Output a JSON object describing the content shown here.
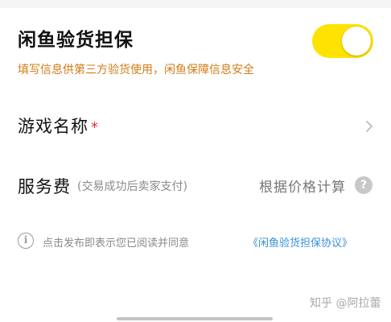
{
  "guarantee": {
    "title": "闲鱼验货担保",
    "description": "填写信息供第三方验货使用，闲鱼保障信息安全",
    "enabled": true,
    "toggle_color": "#ffe300"
  },
  "game_name": {
    "label": "游戏名称",
    "required_mark": "*",
    "icon": "chevron-right-icon"
  },
  "service_fee": {
    "label": "服务费",
    "note": "(交易成功后卖家支付)",
    "value": "根据价格计算",
    "help_glyph": "?"
  },
  "agreement": {
    "info_glyph": "i",
    "text": "点击发布即表示您已阅读并同意",
    "link": "《闲鱼验货担保协议》",
    "link_color": "#3a8fd9"
  },
  "watermark": "知乎 @阿拉蕾"
}
